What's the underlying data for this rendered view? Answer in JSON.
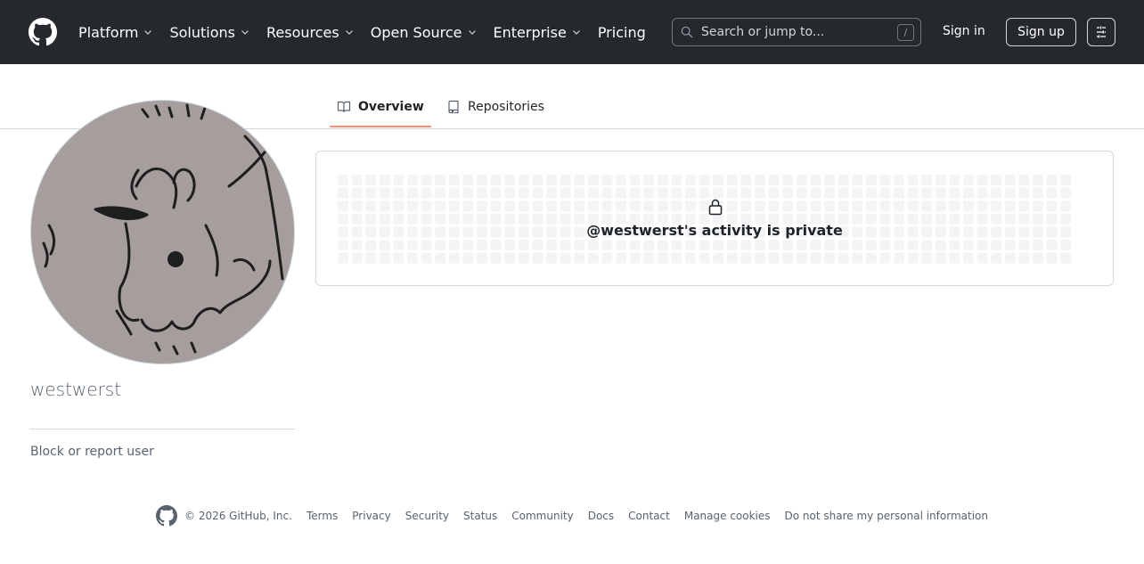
{
  "header": {
    "nav": [
      {
        "label": "Platform",
        "has_dropdown": true
      },
      {
        "label": "Solutions",
        "has_dropdown": true
      },
      {
        "label": "Resources",
        "has_dropdown": true
      },
      {
        "label": "Open Source",
        "has_dropdown": true
      },
      {
        "label": "Enterprise",
        "has_dropdown": true
      },
      {
        "label": "Pricing",
        "has_dropdown": false
      }
    ],
    "search": {
      "placeholder": "Search or jump to...",
      "shortcut": "/"
    },
    "sign_in": "Sign in",
    "sign_up": "Sign up"
  },
  "tabs": [
    {
      "label": "Overview",
      "icon": "book-icon",
      "selected": true
    },
    {
      "label": "Repositories",
      "icon": "repo-icon",
      "selected": false
    }
  ],
  "profile": {
    "username": "westwerst",
    "block_link": "Block or report user"
  },
  "activity": {
    "message": "@westwerst's activity is private",
    "icon": "lock-icon"
  },
  "footer": {
    "copyright": "© 2026 GitHub, Inc.",
    "links": [
      "Terms",
      "Privacy",
      "Security",
      "Status",
      "Community",
      "Docs",
      "Contact",
      "Manage cookies",
      "Do not share my personal information"
    ]
  },
  "colors": {
    "header_bg": "#25292e",
    "tab_underline": "#fd8c73",
    "muted_text": "#59636e",
    "border": "#d1d9e0"
  }
}
